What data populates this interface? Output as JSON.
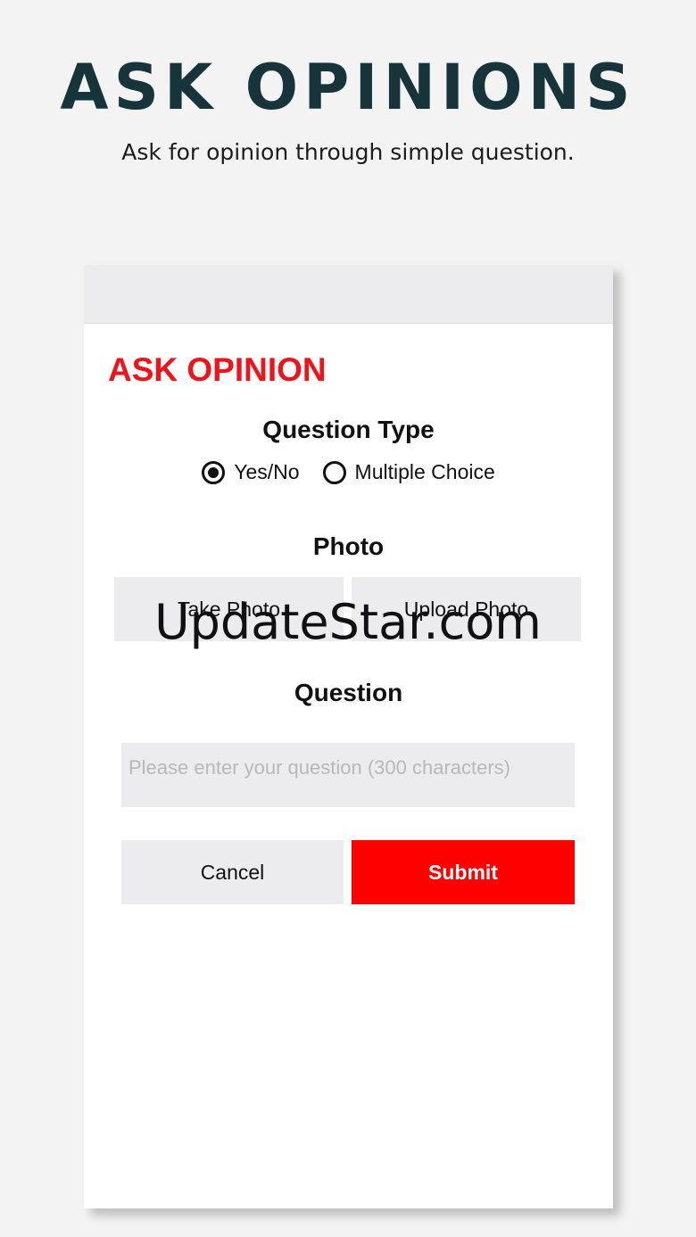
{
  "hero": {
    "title": "ASK OPINIONS",
    "subtitle": "Ask for opinion through simple question."
  },
  "screen": {
    "title": "ASK OPINION",
    "question_type": {
      "label": "Question Type",
      "options": [
        "Yes/No",
        "Multiple Choice"
      ],
      "selected": "Yes/No"
    },
    "photo": {
      "label": "Photo",
      "take_photo": "Take Photo",
      "upload_photo": "Upload Photo"
    },
    "question": {
      "label": "Question",
      "placeholder": "Please enter your question (300 characters)",
      "value": ""
    },
    "actions": {
      "cancel": "Cancel",
      "submit": "Submit"
    }
  },
  "watermark": "UpdateStar.com",
  "colors": {
    "accent": "#fe0000",
    "title_red": "#f0141a",
    "hero_title": "#17343a",
    "button_gray": "#ececee"
  }
}
